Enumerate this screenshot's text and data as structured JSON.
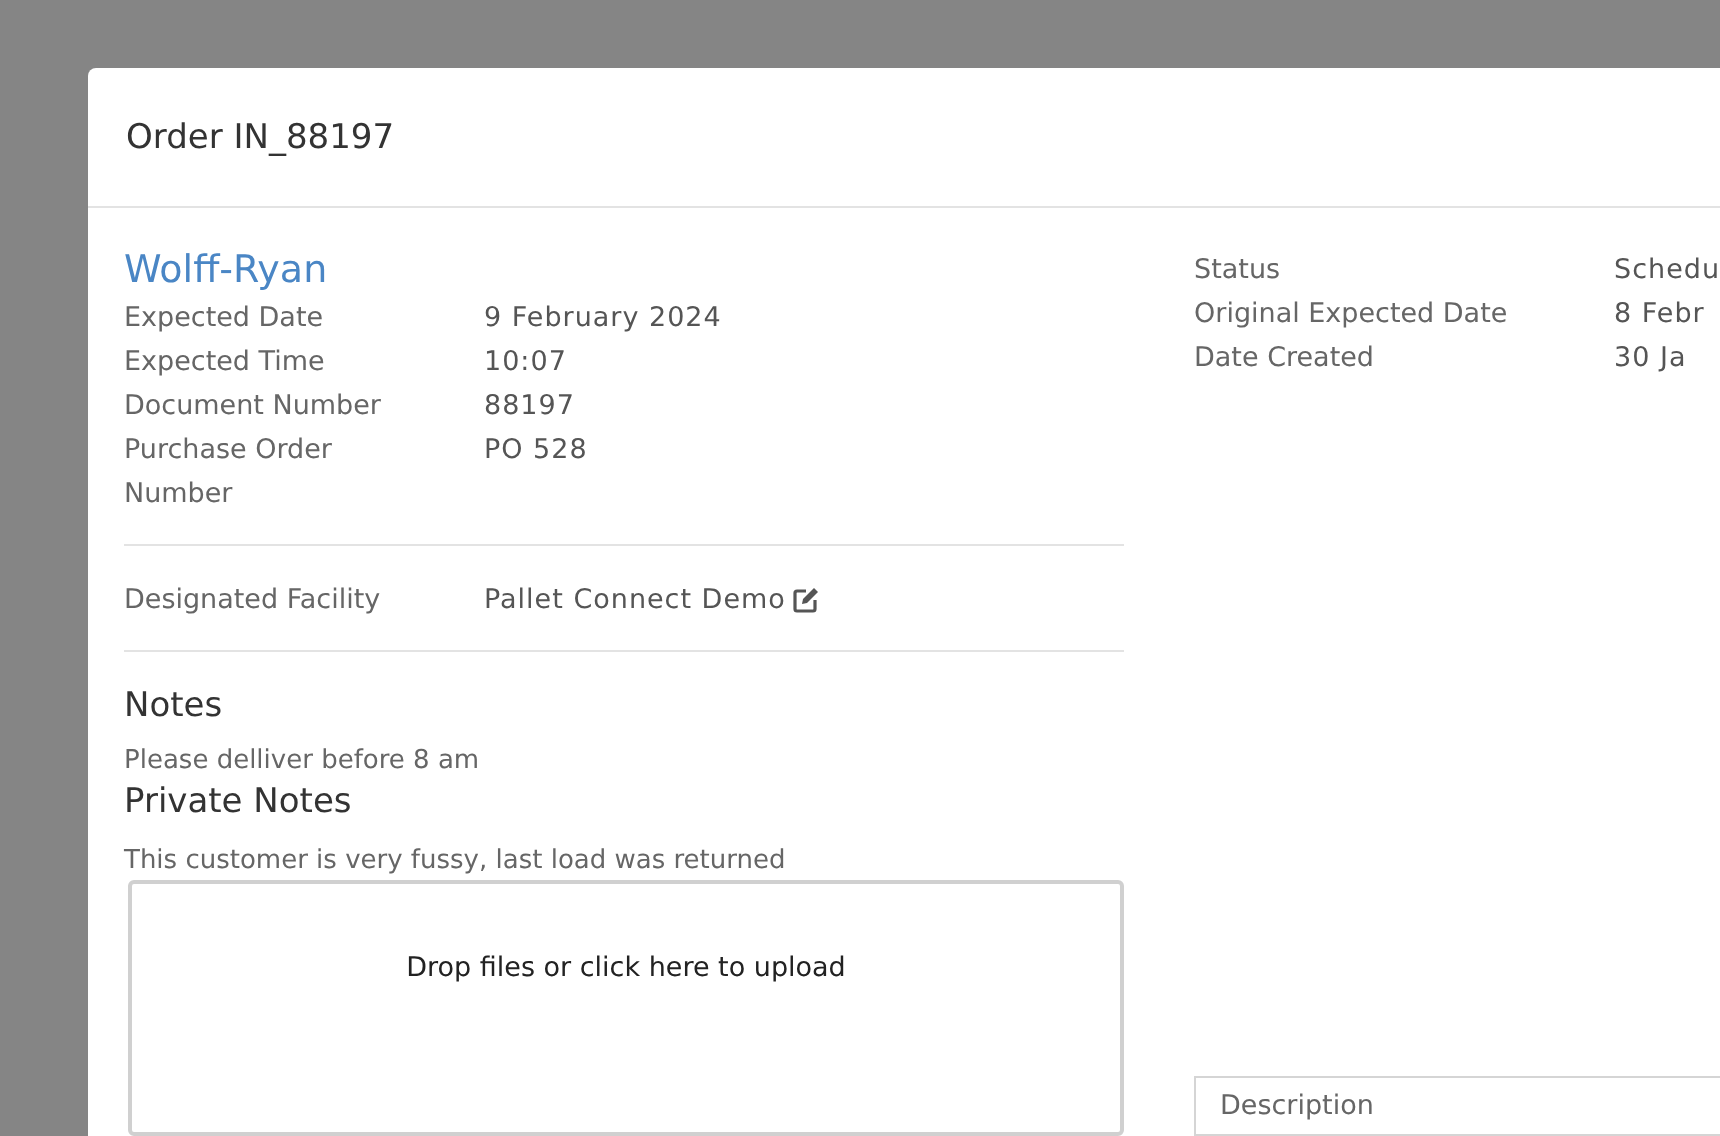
{
  "modal": {
    "title": "Order IN_88197"
  },
  "customer": {
    "name": "Wolff-Ryan"
  },
  "details": [
    {
      "label": "Expected Date",
      "value": "9 February 2024"
    },
    {
      "label": "Expected Time",
      "value": "10:07"
    },
    {
      "label": "Document Number",
      "value": "88197"
    },
    {
      "label": "Purchase Order Number",
      "value": "PO 528"
    }
  ],
  "facility": {
    "label": "Designated Facility",
    "value": "Pallet Connect Demo"
  },
  "notes": {
    "heading": "Notes",
    "text": "Please delliver before 8 am"
  },
  "private_notes": {
    "heading": "Private Notes",
    "text": "This customer is very fussy, last load was returned"
  },
  "upload": {
    "text": "Drop files or click here to upload"
  },
  "status_info": [
    {
      "label": "Status",
      "value": "Schedu"
    },
    {
      "label": "Original Expected Date",
      "value": "8 Febr"
    },
    {
      "label": "Date Created",
      "value": "30 Ja"
    }
  ],
  "description": {
    "placeholder": "Description"
  }
}
